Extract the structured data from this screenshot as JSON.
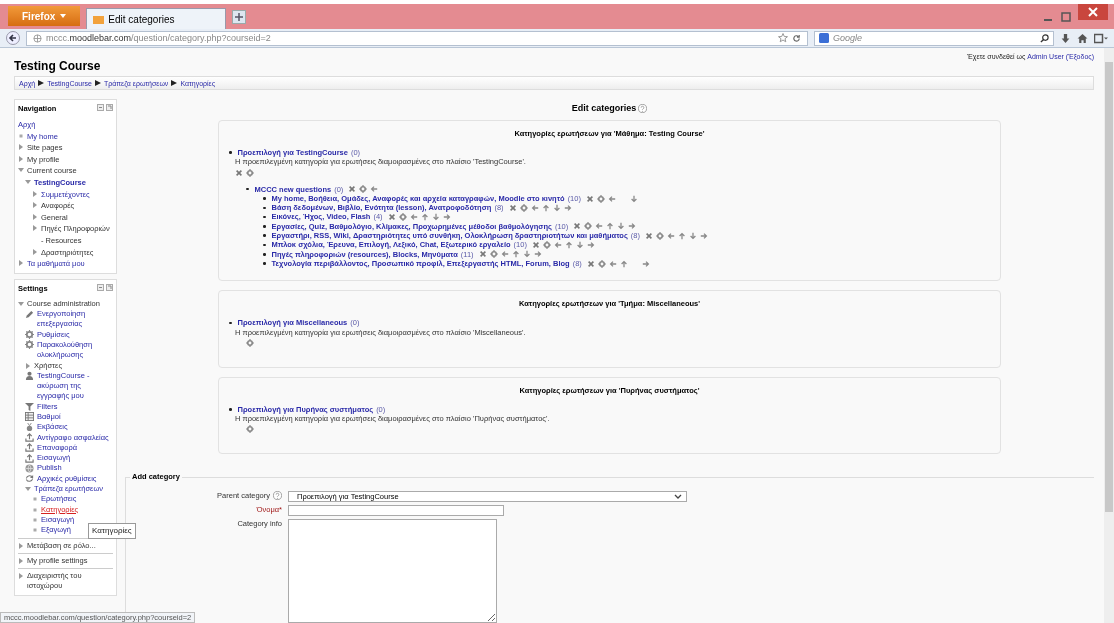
{
  "browser": {
    "menu_button": "Firefox",
    "tabs": [
      {
        "title": "Edit categories",
        "selected": true
      }
    ],
    "url_host_prefix": "mccc.",
    "url_host": "moodlebar.com",
    "url_path": "/question/category.php?courseid=2",
    "search_placeholder": "Google"
  },
  "header": {
    "title": "Testing Course",
    "login_prefix": "Έχετε συνδεθεί ως",
    "login_user": "Admin User",
    "logout": "(Έξοδος)"
  },
  "breadcrumb": [
    "Αρχή",
    "TestingCourse",
    "Τράπεζα ερωτήσεων",
    "Κατηγορίες"
  ],
  "navigation": {
    "title": "Navigation",
    "items": [
      {
        "label": "Αρχή",
        "kind": "plain",
        "link": true
      },
      {
        "label": "My home",
        "kind": "leaf",
        "link": true
      },
      {
        "label": "Site pages",
        "kind": "branch",
        "expanded": false,
        "link": false
      },
      {
        "label": "My profile",
        "kind": "branch",
        "expanded": false,
        "link": false
      },
      {
        "label": "Current course",
        "kind": "branch",
        "expanded": true,
        "link": false,
        "children": [
          {
            "label": "TestingCourse",
            "kind": "branch",
            "expanded": true,
            "link": true,
            "bold": true,
            "children": [
              {
                "label": "Συμμετέχοντες",
                "kind": "branch",
                "expanded": false,
                "link": true
              },
              {
                "label": "Αναφορές",
                "kind": "branch",
                "expanded": false,
                "link": false
              },
              {
                "label": "General",
                "kind": "branch",
                "expanded": false,
                "link": false
              },
              {
                "label": "Πηγές Πληροφοριών - Resources",
                "kind": "branch",
                "expanded": false,
                "link": false
              },
              {
                "label": "Δραστηριότητες",
                "kind": "branch",
                "expanded": false,
                "link": false
              }
            ]
          }
        ]
      },
      {
        "label": "Τα μαθήματά μου",
        "kind": "branch",
        "expanded": false,
        "link": true
      }
    ]
  },
  "settings": {
    "title": "Settings",
    "items": [
      {
        "label": "Course administration",
        "kind": "branch",
        "expanded": true,
        "link": false,
        "children": [
          {
            "label": "Ενεργοποίηση επεξεργασίας",
            "kind": "icon",
            "link": true
          },
          {
            "label": "Ρυθμίσεις",
            "kind": "icon",
            "link": true
          },
          {
            "label": "Παρακολούθηση ολοκλήρωσης",
            "kind": "icon",
            "link": true
          },
          {
            "label": "Χρήστες",
            "kind": "branch",
            "expanded": false,
            "link": false
          },
          {
            "label": "TestingCourse - ακύρωση της εγγραφής μου",
            "kind": "icon",
            "link": true
          },
          {
            "label": "Filters",
            "kind": "icon",
            "link": true
          },
          {
            "label": "Βαθμοί",
            "kind": "icon",
            "link": true
          },
          {
            "label": "Εκβάσεις",
            "kind": "icon",
            "link": true
          },
          {
            "label": "Αντίγραφο ασφαλείας",
            "kind": "icon",
            "link": true
          },
          {
            "label": "Επαναφορά",
            "kind": "icon",
            "link": true
          },
          {
            "label": "Εισαγωγή",
            "kind": "icon",
            "link": true
          },
          {
            "label": "Publish",
            "kind": "icon",
            "link": true
          },
          {
            "label": "Αρχικές ρυθμίσεις",
            "kind": "icon",
            "link": true
          },
          {
            "label": "Τράπεζα ερωτήσεων",
            "kind": "branch",
            "expanded": true,
            "link": true,
            "children": [
              {
                "label": "Ερωτήσεις",
                "kind": "leaf",
                "link": true,
                "selected": false
              },
              {
                "label": "Κατηγορίες",
                "kind": "leaf",
                "link": true,
                "selected": true
              },
              {
                "label": "Εισαγωγή",
                "kind": "leaf",
                "link": true,
                "selected": false
              },
              {
                "label": "Εξαγωγή",
                "kind": "leaf",
                "link": true,
                "selected": false
              }
            ]
          }
        ]
      },
      {
        "label": "Μετάβαση σε ρόλο...",
        "kind": "branch",
        "expanded": false,
        "link": false
      },
      {
        "label": "My profile settings",
        "kind": "branch",
        "expanded": false,
        "link": false
      },
      {
        "label": "Διαχειριστής του ιστοχώρου",
        "kind": "branch",
        "expanded": false,
        "link": false
      }
    ]
  },
  "tooltip": "Κατηγορίες",
  "main": {
    "title": "Edit categories",
    "contexts": [
      {
        "title": "Κατηγορίες ερωτήσεων για 'Μάθημα: Testing Course'",
        "items": [
          {
            "name": "Προεπιλογή για TestingCourse",
            "count": "(0)",
            "description": "Η προεπιλεγμένη κατηγορία για ερωτήσεις διαμοιρασμένες στο πλαίσιο 'TestingCourse'.",
            "can_delete": true,
            "can_move_left": false,
            "can_move_up": false,
            "can_move_down": false,
            "can_move_right": false,
            "children": [
              {
                "name": "MCCC new questions",
                "count": "(0)",
                "can_delete": true,
                "can_move_left": true,
                "can_move_up": false,
                "can_move_down": false,
                "can_move_right": false,
                "children": [
                  {
                    "name": "My home, Βοήθεια, Ομάδες, Αναφορές και αρχεία καταγραφών, Moodle στο κινητό",
                    "count": "(10)",
                    "can_delete": true,
                    "can_move_left": true,
                    "can_move_up": false,
                    "can_move_down": true,
                    "can_move_right": false
                  },
                  {
                    "name": "Βάση δεδομένων, Βιβλίο, Ενότητα (lesson), Ανατροφοδότηση",
                    "count": "(8)",
                    "can_delete": true,
                    "can_move_left": true,
                    "can_move_up": true,
                    "can_move_down": true,
                    "can_move_right": true
                  },
                  {
                    "name": "Εικόνες, Ήχος, Video, Flash",
                    "count": "(4)",
                    "can_delete": true,
                    "can_move_left": true,
                    "can_move_up": true,
                    "can_move_down": true,
                    "can_move_right": true
                  },
                  {
                    "name": "Εργασίες, Quiz, Βαθμολόγιο, Κλίμακες, Προχωρημένες μέθοδοι βαθμολόγησης",
                    "count": "(10)",
                    "can_delete": true,
                    "can_move_left": true,
                    "can_move_up": true,
                    "can_move_down": true,
                    "can_move_right": true
                  },
                  {
                    "name": "Εργαστήρι, RSS, Wiki, Δραστηριότητες υπό συνθήκη, Ολοκλήρωση δραστηριοτήτων και μαθήματος",
                    "count": "(8)",
                    "can_delete": true,
                    "can_move_left": true,
                    "can_move_up": true,
                    "can_move_down": true,
                    "can_move_right": true
                  },
                  {
                    "name": "Μπλοκ σχόλια, Έρευνα, Επιλογή, Λεξικό, Chat, Εξωτερικό εργαλείο",
                    "count": "(10)",
                    "can_delete": true,
                    "can_move_left": true,
                    "can_move_up": true,
                    "can_move_down": true,
                    "can_move_right": true
                  },
                  {
                    "name": "Πηγές πληροφοριών (resources), Blocks, Μηνύματα",
                    "count": "(11)",
                    "can_delete": true,
                    "can_move_left": true,
                    "can_move_up": true,
                    "can_move_down": true,
                    "can_move_right": true
                  },
                  {
                    "name": "Τεχνολογία περιβάλλοντος, Προσωπικό προφίλ, Επεξεργαστής HTML, Forum, Blog",
                    "count": "(8)",
                    "can_delete": true,
                    "can_move_left": true,
                    "can_move_up": true,
                    "can_move_down": false,
                    "can_move_right": true
                  }
                ]
              }
            ]
          }
        ]
      },
      {
        "title": "Κατηγορίες ερωτήσεων για 'Τμήμα: Miscellaneous'",
        "items": [
          {
            "name": "Προεπιλογή για Miscellaneous",
            "count": "(0)",
            "description": "Η προεπιλεγμένη κατηγορία για ερωτήσεις διαμοιρασμένες στο πλαίσιο 'Miscellaneous'.",
            "can_delete": false,
            "can_move_left": false,
            "can_move_up": false,
            "can_move_down": false,
            "can_move_right": false
          }
        ]
      },
      {
        "title": "Κατηγορίες ερωτήσεων για 'Πυρήνας συστήματος'",
        "items": [
          {
            "name": "Προεπιλογή για Πυρήνας συστήματος",
            "count": "(0)",
            "description": "Η προεπιλεγμένη κατηγορία για ερωτήσεις διαμοιρασμένες στο πλαίσιο 'Πυρήνας συστήματος'.",
            "can_delete": false,
            "can_move_left": false,
            "can_move_up": false,
            "can_move_down": false,
            "can_move_right": false
          }
        ]
      }
    ]
  },
  "add_category": {
    "legend": "Add category",
    "parent_label": "Parent category",
    "parent_value": "Προεπιλογή για TestingCourse",
    "name_label": "Όνομα*",
    "info_label": "Category info"
  },
  "status_bar": "mccc.moodlebar.com/question/category.php?courseid=2"
}
